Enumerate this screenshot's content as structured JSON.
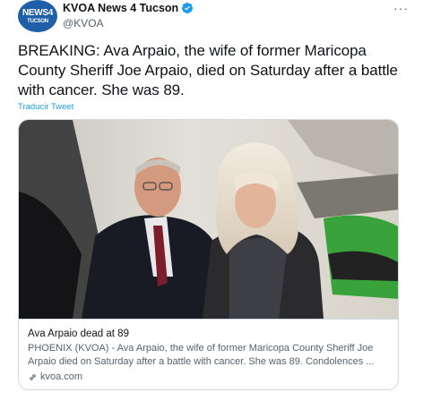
{
  "account": {
    "display_name": "KVOA News 4 Tucson",
    "handle": "@KVOA",
    "avatar_text": "NEWS4",
    "avatar_subtext": "TUCSON",
    "verified": true
  },
  "more_menu_label": "···",
  "tweet": {
    "text": "BREAKING: Ava Arpaio, the wife of former Maricopa County Sheriff Joe Arpaio, died on Saturday after a battle with cancer. She was 89.",
    "translate_label": "Traducir Tweet"
  },
  "card": {
    "title": "Ava Arpaio dead at 89",
    "description": "PHOENIX (KVOA) - Ava Arpaio, the wife of former Maricopa County Sheriff Joe Arpaio died on Saturday after a battle with cancer. She was 89. Condolences ...",
    "domain": "kvoa.com"
  },
  "colors": {
    "accent": "#1d9bf0",
    "brand": "#1f5fa8",
    "text": "#0f1419",
    "secondary": "#536471",
    "border": "#cfd9de"
  },
  "icons": {
    "verified": "verified-badge-icon",
    "more": "more-icon",
    "link": "link-icon"
  }
}
